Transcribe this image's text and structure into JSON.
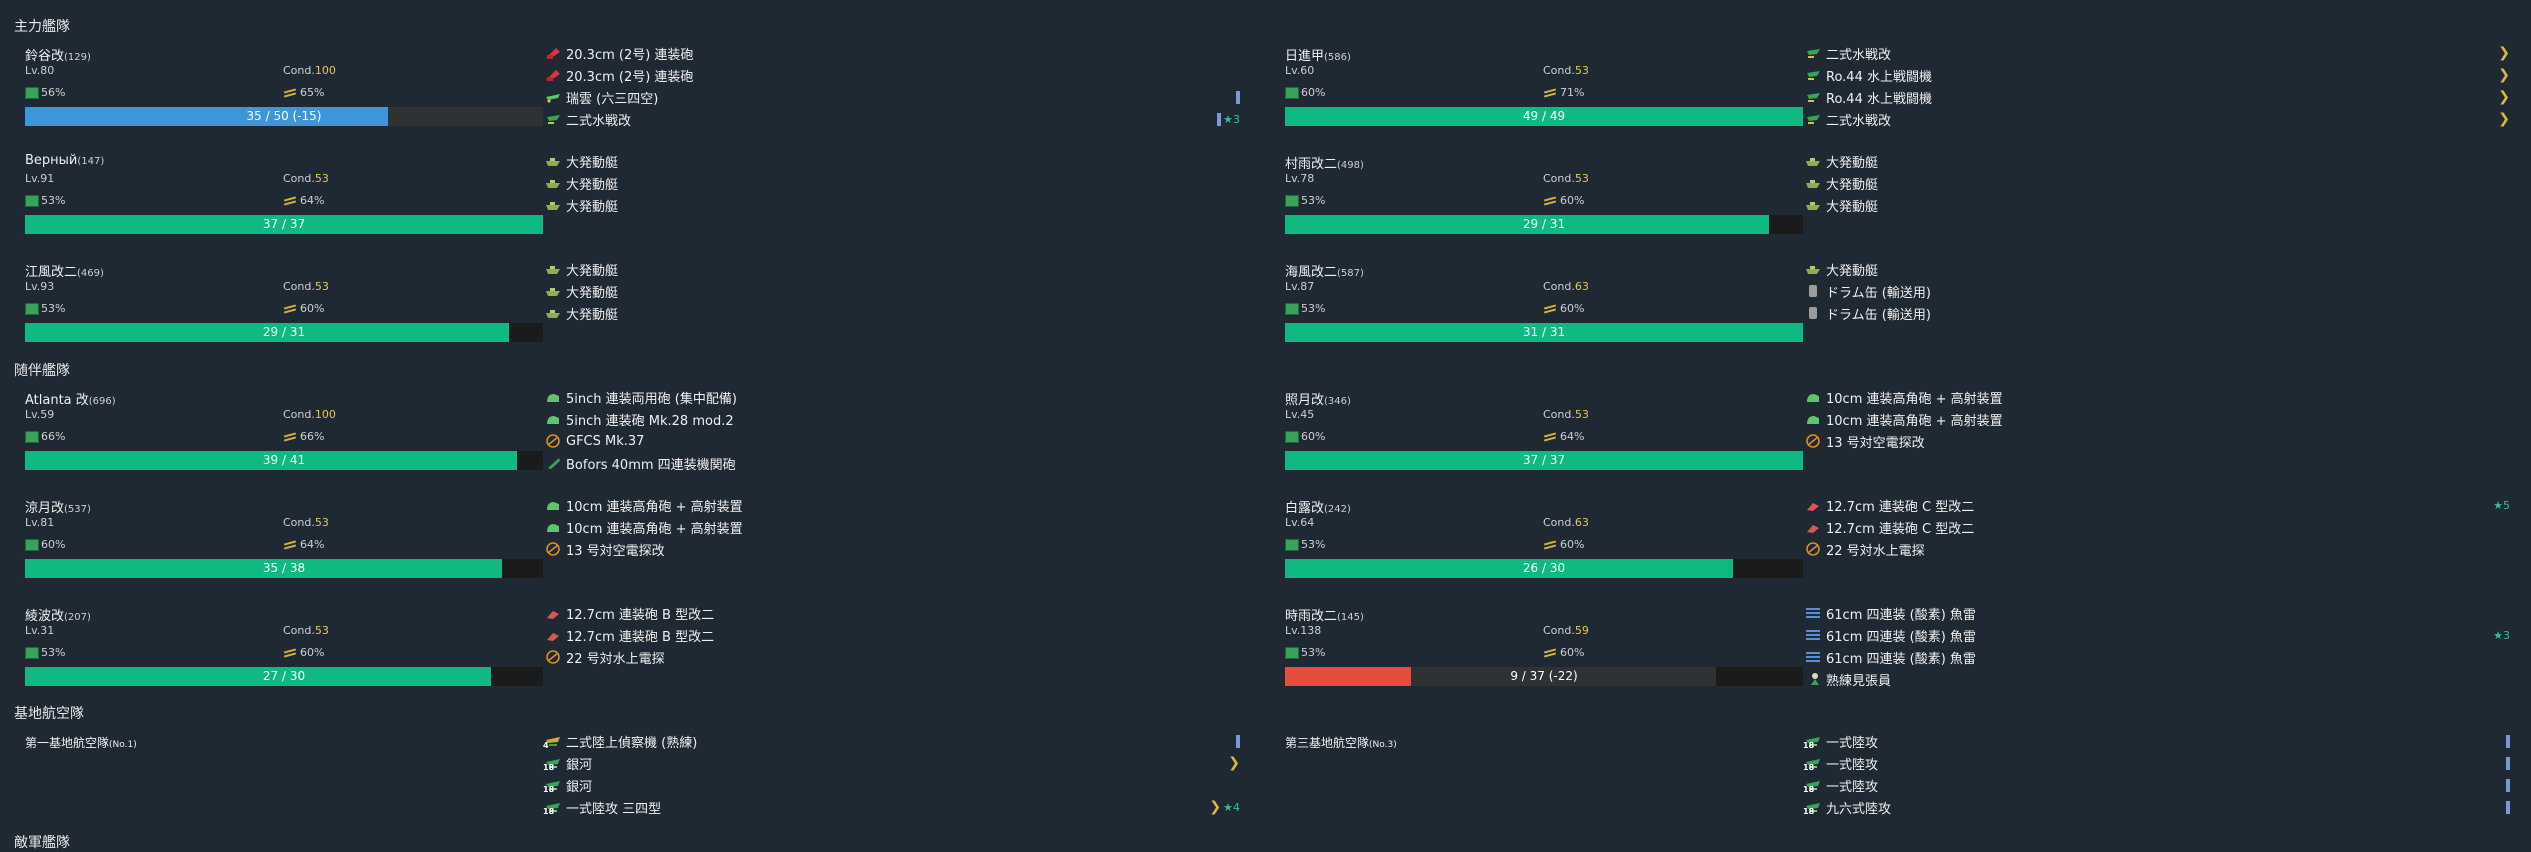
{
  "sections": {
    "main_fleet": "主力艦隊",
    "escort_fleet": "随伴艦隊",
    "base_air": "基地航空隊",
    "next": "敵軍艦隊"
  },
  "colors": {
    "green": "#10b981",
    "blue": "#3b97da",
    "red": "#e74c3c",
    "cond_yellow": "#e6c84a"
  },
  "main_ships": [
    {
      "name": "鈴谷改",
      "id": "(129)",
      "lv": "Lv.80",
      "cond_label": "Cond.",
      "cond": "100",
      "fuel": "56%",
      "ammo": "65%",
      "hp": "35 / 50 (-15)",
      "hp_ratio": 0.7,
      "bar_color": "blue"
    },
    {
      "name": "日進甲",
      "id": "(586)",
      "lv": "Lv.60",
      "cond_label": "Cond.",
      "cond": "53",
      "fuel": "60%",
      "ammo": "71%",
      "hp": "49 / 49",
      "hp_ratio": 1.0,
      "bar_color": "green"
    },
    {
      "name": "Верный",
      "id": "(147)",
      "lv": "Lv.91",
      "cond_label": "Cond.",
      "cond": "53",
      "fuel": "53%",
      "ammo": "64%",
      "hp": "37 / 37",
      "hp_ratio": 1.0,
      "bar_color": "green"
    },
    {
      "name": "村雨改二",
      "id": "(498)",
      "lv": "Lv.78",
      "cond_label": "Cond.",
      "cond": "53",
      "fuel": "53%",
      "ammo": "60%",
      "hp": "29 / 31",
      "hp_ratio": 0.935,
      "bar_color": "green"
    },
    {
      "name": "江風改二",
      "id": "(469)",
      "lv": "Lv.93",
      "cond_label": "Cond.",
      "cond": "53",
      "fuel": "53%",
      "ammo": "60%",
      "hp": "29 / 31",
      "hp_ratio": 0.935,
      "bar_color": "green"
    },
    {
      "name": "海風改二",
      "id": "(587)",
      "lv": "Lv.87",
      "cond_label": "Cond.",
      "cond": "63",
      "fuel": "53%",
      "ammo": "60%",
      "hp": "31 / 31",
      "hp_ratio": 1.0,
      "bar_color": "green"
    }
  ],
  "escort_ships": [
    {
      "name": "Atlanta 改",
      "id": "(696)",
      "lv": "Lv.59",
      "cond_label": "Cond.",
      "cond": "100",
      "fuel": "66%",
      "ammo": "66%",
      "hp": "39 / 41",
      "hp_ratio": 0.95,
      "bar_color": "green"
    },
    {
      "name": "照月改",
      "id": "(346)",
      "lv": "Lv.45",
      "cond_label": "Cond.",
      "cond": "53",
      "fuel": "60%",
      "ammo": "64%",
      "hp": "37 / 37",
      "hp_ratio": 1.0,
      "bar_color": "green"
    },
    {
      "name": "涼月改",
      "id": "(537)",
      "lv": "Lv.81",
      "cond_label": "Cond.",
      "cond": "53",
      "fuel": "60%",
      "ammo": "64%",
      "hp": "35 / 38",
      "hp_ratio": 0.92,
      "bar_color": "green"
    },
    {
      "name": "白露改",
      "id": "(242)",
      "lv": "Lv.64",
      "cond_label": "Cond.",
      "cond": "63",
      "fuel": "53%",
      "ammo": "60%",
      "hp": "26 / 30",
      "hp_ratio": 0.865,
      "bar_color": "green"
    },
    {
      "name": "綾波改",
      "id": "(207)",
      "lv": "Lv.31",
      "cond_label": "Cond.",
      "cond": "53",
      "fuel": "53%",
      "ammo": "60%",
      "hp": "27 / 30",
      "hp_ratio": 0.9,
      "bar_color": "green"
    },
    {
      "name": "時雨改二",
      "id": "(145)",
      "lv": "Lv.138",
      "cond_label": "Cond.",
      "cond": "59",
      "fuel": "53%",
      "ammo": "60%",
      "hp": "9 / 37 (-22)",
      "hp_ratio": 0.243,
      "bar_color": "red"
    }
  ],
  "main_equips": [
    [
      {
        "label": "20.3cm (2号) 連装砲",
        "icon": "main-gun-icon"
      },
      {
        "label": "20.3cm (2号) 連装砲",
        "icon": "main-gun-icon"
      },
      {
        "label": "瑞雲 (六三四空)",
        "icon": "seaplane-bomber-icon",
        "prof": "bar"
      },
      {
        "label": "二式水戦改",
        "icon": "seaplane-fighter-icon",
        "prof": "bar",
        "star": "★3"
      }
    ],
    [
      {
        "label": "二式水戦改",
        "icon": "seaplane-fighter-icon",
        "prof": "chev"
      },
      {
        "label": "Ro.44 水上戦闘機",
        "icon": "seaplane-fighter-icon",
        "prof": "chev"
      },
      {
        "label": "Ro.44 水上戦闘機",
        "icon": "seaplane-fighter-icon",
        "prof": "chev"
      },
      {
        "label": "二式水戦改",
        "icon": "seaplane-fighter-icon",
        "prof": "chev"
      }
    ],
    [
      {
        "label": "大発動艇",
        "icon": "landing-craft-icon"
      },
      {
        "label": "大発動艇",
        "icon": "landing-craft-icon"
      },
      {
        "label": "大発動艇",
        "icon": "landing-craft-icon"
      }
    ],
    [
      {
        "label": "大発動艇",
        "icon": "landing-craft-icon"
      },
      {
        "label": "大発動艇",
        "icon": "landing-craft-icon"
      },
      {
        "label": "大発動艇",
        "icon": "landing-craft-icon"
      }
    ],
    [
      {
        "label": "大発動艇",
        "icon": "landing-craft-icon"
      },
      {
        "label": "大発動艇",
        "icon": "landing-craft-icon"
      },
      {
        "label": "大発動艇",
        "icon": "landing-craft-icon"
      }
    ],
    [
      {
        "label": "大発動艇",
        "icon": "landing-craft-icon"
      },
      {
        "label": "ドラム缶 (輸送用)",
        "icon": "drum-icon"
      },
      {
        "label": "ドラム缶 (輸送用)",
        "icon": "drum-icon"
      }
    ]
  ],
  "escort_equips": [
    [
      {
        "label": "5inch 連装両用砲 (集中配備)",
        "icon": "secondary-gun-icon"
      },
      {
        "label": "5inch 連装砲 Mk.28 mod.2",
        "icon": "secondary-gun-icon"
      },
      {
        "label": "GFCS Mk.37",
        "icon": "radar-icon"
      },
      {
        "label": "Bofors 40mm 四連装機関砲",
        "icon": "aa-gun-icon"
      }
    ],
    [
      {
        "label": "10cm 連装高角砲 + 高射装置",
        "icon": "secondary-gun-icon"
      },
      {
        "label": "10cm 連装高角砲 + 高射装置",
        "icon": "secondary-gun-icon"
      },
      {
        "label": "13 号対空電探改",
        "icon": "radar-icon"
      }
    ],
    [
      {
        "label": "10cm 連装高角砲 + 高射装置",
        "icon": "secondary-gun-icon"
      },
      {
        "label": "10cm 連装高角砲 + 高射装置",
        "icon": "secondary-gun-icon"
      },
      {
        "label": "13 号対空電探改",
        "icon": "radar-icon"
      }
    ],
    [
      {
        "label": "12.7cm 連装砲 C 型改二",
        "icon": "small-gun-icon",
        "star": "★5"
      },
      {
        "label": "12.7cm 連装砲 C 型改二",
        "icon": "small-gun-icon"
      },
      {
        "label": "22 号対水上電探",
        "icon": "radar-icon"
      }
    ],
    [
      {
        "label": "12.7cm 連装砲 B 型改二",
        "icon": "small-gun-icon"
      },
      {
        "label": "12.7cm 連装砲 B 型改二",
        "icon": "small-gun-icon"
      },
      {
        "label": "22 号対水上電探",
        "icon": "radar-icon"
      }
    ],
    [
      {
        "label": "61cm 四連装 (酸素) 魚雷",
        "icon": "torpedo-icon"
      },
      {
        "label": "61cm 四連装 (酸素) 魚雷",
        "icon": "torpedo-icon",
        "star": "★3"
      },
      {
        "label": "61cm 四連装 (酸素) 魚雷",
        "icon": "torpedo-icon"
      },
      {
        "label": "熟練見張員",
        "icon": "lookout-icon"
      }
    ]
  ],
  "bases": [
    {
      "name": "第一基地航空隊",
      "no": "(No.1)",
      "equips": [
        {
          "label": "二式陸上偵察機 (熟練)",
          "icon": "land-recon-icon",
          "num": "4",
          "prof": "bar"
        },
        {
          "label": "銀河",
          "icon": "land-bomber-icon",
          "num": "18",
          "prof": "chev"
        },
        {
          "label": "銀河",
          "icon": "land-bomber-icon",
          "num": "18"
        },
        {
          "label": "一式陸攻 三四型",
          "icon": "land-bomber-icon",
          "num": "18",
          "prof": "chev",
          "star": "★4"
        }
      ]
    },
    {
      "name": "第三基地航空隊",
      "no": "(No.3)",
      "equips": [
        {
          "label": "一式陸攻",
          "icon": "land-bomber-icon",
          "num": "18",
          "prof": "bar"
        },
        {
          "label": "一式陸攻",
          "icon": "land-bomber-icon",
          "num": "18",
          "prof": "bar"
        },
        {
          "label": "一式陸攻",
          "icon": "land-bomber-icon",
          "num": "18",
          "prof": "bar"
        },
        {
          "label": "九六式陸攻",
          "icon": "land-bomber-icon",
          "num": "18",
          "prof": "bar"
        }
      ]
    }
  ]
}
